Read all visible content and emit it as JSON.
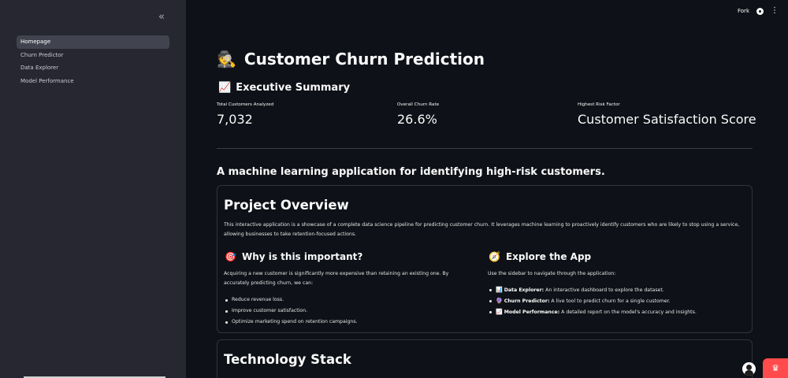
{
  "sidebar": {
    "collapse_glyph": "«",
    "items": [
      {
        "label": "Homepage",
        "active": true
      },
      {
        "label": "Churn Predictor",
        "active": false
      },
      {
        "label": "Data Explorer",
        "active": false
      },
      {
        "label": "Model Performance",
        "active": false
      }
    ]
  },
  "topbar": {
    "fork_label": "Fork",
    "github_icon": "github-icon",
    "menu_icon": "kebab-menu-icon"
  },
  "page": {
    "title_icon": "🕵️",
    "title": "Customer Churn Prediction",
    "summary_icon": "📈",
    "summary_heading": "Executive Summary",
    "metrics": [
      {
        "label": "Total Customers Analyzed",
        "value": "7,032"
      },
      {
        "label": "Overall Churn Rate",
        "value": "26.6%"
      },
      {
        "label": "Highest Risk Factor",
        "value": "Customer Satisfaction Score"
      }
    ],
    "subtitle": "A machine learning application for identifying high-risk customers."
  },
  "overview": {
    "heading": "Project Overview",
    "paragraph": "This interactive application is a showcase of a complete data science pipeline for predicting customer churn. It leverages machine learning to proactively identify customers who are likely to stop using a service, allowing businesses to take retention-focused actions.",
    "why": {
      "icon": "🎯",
      "heading": "Why is this important?",
      "paragraph": "Acquiring a new customer is significantly more expensive than retaining an existing one. By accurately predicting churn, we can:",
      "bullets": [
        "Reduce revenue loss.",
        "Improve customer satisfaction.",
        "Optimize marketing spend on retention campaigns."
      ]
    },
    "explore": {
      "icon": "🧭",
      "heading": "Explore the App",
      "paragraph": "Use the sidebar to navigate through the application:",
      "items": [
        {
          "icon": "📊",
          "bold": "Data Explorer:",
          "text": " An interactive dashboard to explore the dataset."
        },
        {
          "icon": "🔮",
          "bold": "Churn Predictor:",
          "text": " A live tool to predict churn for a single customer."
        },
        {
          "icon": "📈",
          "bold": "Model Performance:",
          "text": " A detailed report on the model's accuracy and insights."
        }
      ]
    }
  },
  "tech": {
    "heading": "Technology Stack"
  },
  "colors": {
    "background": "#0e1117",
    "sidebar": "#262730",
    "accent": "#ff4b4b"
  }
}
